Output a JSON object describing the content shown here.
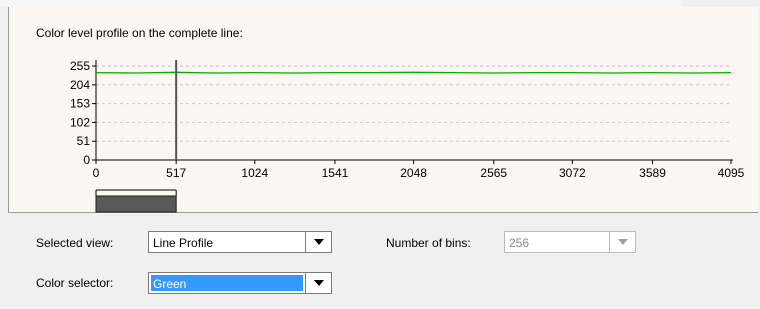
{
  "panel": {
    "title": "Color level profile on the complete line:"
  },
  "chart_data": {
    "type": "line",
    "title": "",
    "xlabel": "",
    "ylabel": "",
    "x_ticks": [
      0,
      517,
      1024,
      1541,
      2048,
      2565,
      3072,
      3589,
      4095
    ],
    "y_ticks": [
      0,
      51,
      102,
      153,
      204,
      255
    ],
    "xlim": [
      0,
      4095
    ],
    "ylim": [
      0,
      255
    ],
    "grid": "horizontal dashed",
    "reference_line_y": 255,
    "cursor_x": 517,
    "series": [
      {
        "color": "#00b000",
        "x": [
          0,
          256,
          512,
          768,
          1024,
          1280,
          1536,
          1792,
          2048,
          2304,
          2560,
          2816,
          3072,
          3328,
          3584,
          3840,
          4095
        ],
        "values": [
          237,
          236,
          238,
          236,
          237,
          236,
          237,
          237,
          238,
          237,
          236,
          237,
          237,
          236,
          237,
          236,
          237
        ]
      }
    ],
    "scrollbar": {
      "thumb_start": 0,
      "thumb_end": 517
    }
  },
  "controls": {
    "selected_view": {
      "label": "Selected view:",
      "value": "Line Profile"
    },
    "number_of_bins": {
      "label": "Number of bins:",
      "value": "256"
    },
    "color_selector": {
      "label": "Color selector:",
      "value": "Green"
    }
  },
  "colors": {
    "plot_line": "#00b000",
    "selection": "#3399ff"
  },
  "icons": {
    "dropdown": "down-triangle"
  }
}
